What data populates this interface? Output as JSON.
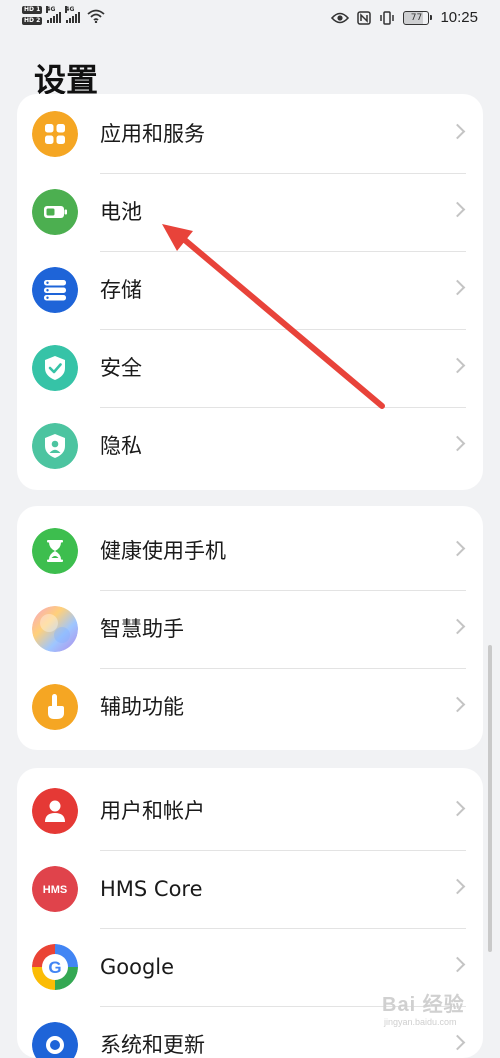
{
  "status_bar": {
    "sim1": "HD 1",
    "sim2": "HD 2",
    "network1": "4G",
    "network2": "4G",
    "battery_level": "77",
    "time": "10:25"
  },
  "header": {
    "title": "设置"
  },
  "groups": [
    {
      "items": [
        {
          "label": "应用和服务",
          "icon": "apps-grid-icon",
          "color": "#F5A623"
        },
        {
          "label": "电池",
          "icon": "battery-icon",
          "color": "#4CAF50"
        },
        {
          "label": "存储",
          "icon": "storage-icon",
          "color": "#1E64D8"
        },
        {
          "label": "安全",
          "icon": "shield-check-icon",
          "color": "#36C3A7"
        },
        {
          "label": "隐私",
          "icon": "privacy-shield-icon",
          "color": "#4CC4A0"
        }
      ]
    },
    {
      "items": [
        {
          "label": "健康使用手机",
          "icon": "hourglass-icon",
          "color": "#3DBE4E"
        },
        {
          "label": "智慧助手",
          "icon": "smart-assistant-icon",
          "color": "#B08BE8"
        },
        {
          "label": "辅助功能",
          "icon": "hand-touch-icon",
          "color": "#F5A623"
        }
      ]
    },
    {
      "items": [
        {
          "label": "用户和帐户",
          "icon": "user-icon",
          "color": "#E53935"
        },
        {
          "label": "HMS Core",
          "icon": "hms-icon",
          "icon_text": "HMS",
          "color": "#E0434B"
        },
        {
          "label": "Google",
          "icon": "google-icon",
          "color": "#4285F4"
        },
        {
          "label": "系统和更新",
          "icon": "system-update-icon",
          "color": "#1E64D8"
        }
      ]
    }
  ],
  "annotation": {
    "arrow_color": "#E8433A"
  },
  "watermark": {
    "text": "Bai 经验",
    "sub": "jingyan.baidu.com"
  }
}
